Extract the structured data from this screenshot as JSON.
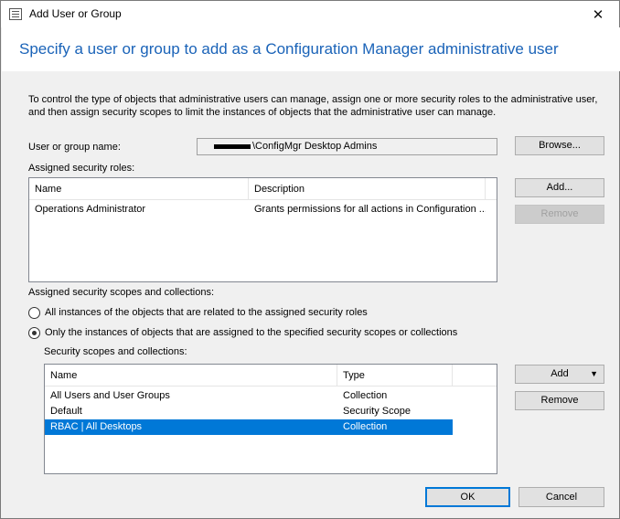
{
  "window": {
    "title": "Add User or Group",
    "close_glyph": "✕",
    "header": "Specify a user or group to add as a Configuration Manager administrative user",
    "description": "To control the type of objects that administrative users can manage, assign one or more security roles  to the  administrative user, and then assign security scopes to limit the instances of objects that the administrative user can manage."
  },
  "user": {
    "label": "User or group name:",
    "value_suffix": "\\ConfigMgr Desktop Admins",
    "browse_label": "Browse..."
  },
  "roles": {
    "label": "Assigned security roles:",
    "columns": [
      "Name",
      "Description"
    ],
    "rows": [
      {
        "name": "Operations Administrator",
        "description": "Grants permissions for all actions in Configuration ..."
      }
    ],
    "add_label": "Add...",
    "remove_label": "Remove"
  },
  "scopes": {
    "label": "Assigned security scopes and collections:",
    "option_all": "All instances of the objects that are related to the assigned security roles",
    "option_only": "Only the instances of objects that are assigned to the specified security scopes or collections",
    "list_label": "Security scopes and collections:",
    "columns": [
      "Name",
      "Type"
    ],
    "rows": [
      {
        "name": "All Users and User Groups",
        "type": "Collection"
      },
      {
        "name": "Default",
        "type": "Security Scope"
      },
      {
        "name": "RBAC | All Desktops",
        "type": "Collection"
      }
    ],
    "add_label": "Add",
    "remove_label": "Remove"
  },
  "footer": {
    "ok_label": "OK",
    "cancel_label": "Cancel"
  },
  "icons": {
    "app": "window-list-icon",
    "close": "close-icon",
    "dropdown": "dropdown-arrow-icon"
  },
  "colors": {
    "header_text": "#1a63b8",
    "selection": "#0078d7"
  }
}
